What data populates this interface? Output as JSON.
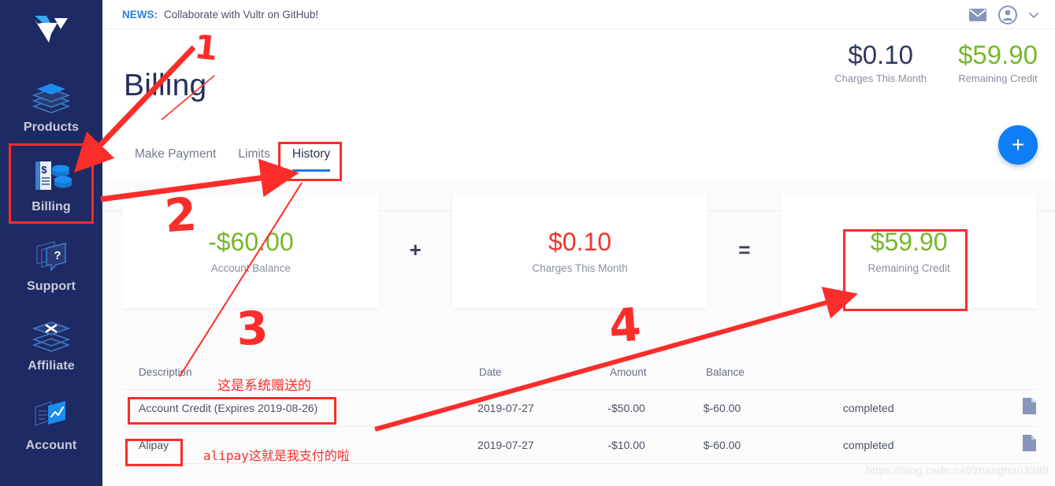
{
  "sidebar": {
    "logo": "vultr-logo",
    "items": [
      {
        "label": "Products",
        "icon": "layers-cube-icon",
        "active": false
      },
      {
        "label": "Billing",
        "icon": "invoice-coins-icon",
        "active": true
      },
      {
        "label": "Support",
        "icon": "layers-question-icon",
        "active": false
      },
      {
        "label": "Affiliate",
        "icon": "layers-x-icon",
        "active": false
      },
      {
        "label": "Account",
        "icon": "layers-chart-icon",
        "active": false
      }
    ]
  },
  "topbar": {
    "news_label": "NEWS:",
    "news_text": "Collaborate with Vultr on GitHub!",
    "icons": [
      "mail-icon",
      "account-circle-icon",
      "chevron-down-icon"
    ]
  },
  "header": {
    "title": "Billing",
    "stats": [
      {
        "value": "$0.10",
        "label": "Charges This Month",
        "color": "#2d3a60"
      },
      {
        "value": "$59.90",
        "label": "Remaining Credit",
        "color": "#76b72a"
      }
    ]
  },
  "tabs": [
    {
      "label": "Make Payment",
      "active": false
    },
    {
      "label": "Limits",
      "active": false
    },
    {
      "label": "History",
      "active": true
    }
  ],
  "fab": {
    "label": "+",
    "icon": "plus-icon",
    "color": "#0d7ef5"
  },
  "summary": {
    "cards": [
      {
        "value": "-$60.00",
        "label": "Account Balance",
        "color": "#76b72a"
      },
      {
        "value": "$0.10",
        "label": "Charges This Month",
        "color": "#f1342a"
      },
      {
        "value": "$59.90",
        "label": "Remaining Credit",
        "color": "#76b72a"
      }
    ],
    "operators": [
      "+",
      "="
    ]
  },
  "table": {
    "columns": [
      "Description",
      "Date",
      "Amount",
      "Balance",
      "",
      ""
    ],
    "rows": [
      {
        "description": "Account Credit (Expires 2019-08-26)",
        "date": "2019-07-27",
        "amount": "-$50.00",
        "balance": "$-60.00",
        "status": "completed",
        "icon": "document-icon"
      },
      {
        "description": "Alipay",
        "date": "2019-07-27",
        "amount": "-$10.00",
        "balance": "$-60.00",
        "status": "completed",
        "icon": "document-icon"
      }
    ]
  },
  "watermark": "https://blog.csdn.net/zhanghao3389",
  "annotations": {
    "color": "#fb2d2a",
    "numbers": [
      "1",
      "2",
      "3",
      "4"
    ],
    "notes": [
      "这是系统赠送的",
      "alipay这就是我支付的啦"
    ]
  }
}
